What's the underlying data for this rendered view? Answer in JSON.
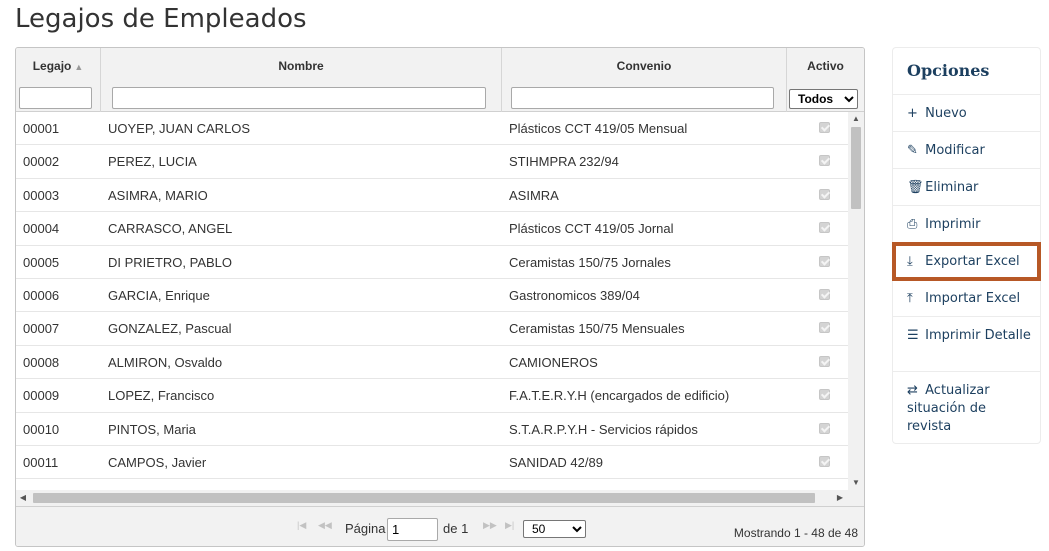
{
  "page": {
    "title": "Legajos de Empleados"
  },
  "grid": {
    "columns": {
      "legajo": "Legajo",
      "nombre": "Nombre",
      "convenio": "Convenio",
      "activo": "Activo"
    },
    "activo_filter": "Todos",
    "rows": [
      {
        "legajo": "00001",
        "nombre": "UOYEP, JUAN CARLOS",
        "convenio": "Plásticos CCT 419/05 Mensual",
        "activo": true
      },
      {
        "legajo": "00002",
        "nombre": "PEREZ, LUCIA",
        "convenio": "STIHMPRA 232/94",
        "activo": true
      },
      {
        "legajo": "00003",
        "nombre": "ASIMRA, MARIO",
        "convenio": "ASIMRA",
        "activo": true
      },
      {
        "legajo": "00004",
        "nombre": "CARRASCO, ANGEL",
        "convenio": "Plásticos CCT 419/05 Jornal",
        "activo": true
      },
      {
        "legajo": "00005",
        "nombre": "DI PRIETRO, PABLO",
        "convenio": "Ceramistas 150/75 Jornales",
        "activo": true
      },
      {
        "legajo": "00006",
        "nombre": "GARCIA, Enrique",
        "convenio": "Gastronomicos 389/04",
        "activo": true
      },
      {
        "legajo": "00007",
        "nombre": "GONZALEZ, Pascual",
        "convenio": "Ceramistas 150/75 Mensuales",
        "activo": true
      },
      {
        "legajo": "00008",
        "nombre": "ALMIRON, Osvaldo",
        "convenio": "CAMIONEROS",
        "activo": true
      },
      {
        "legajo": "00009",
        "nombre": "LOPEZ, Francisco",
        "convenio": "F.A.T.E.R.Y.H (encargados de edificio)",
        "activo": true
      },
      {
        "legajo": "00010",
        "nombre": "PINTOS, Maria",
        "convenio": "S.T.A.R.P.Y.H - Servicios rápidos",
        "activo": true
      },
      {
        "legajo": "00011",
        "nombre": "CAMPOS, Javier",
        "convenio": "SANIDAD 42/89",
        "activo": true
      }
    ],
    "pager": {
      "page_label": "Página",
      "page_value": "1",
      "of_label": "de 1",
      "page_size": "50",
      "info": "Mostrando 1 - 48 de 48"
    }
  },
  "options": {
    "title": "Opciones",
    "items": [
      {
        "icon": "plus-icon",
        "glyph": "+",
        "label": "Nuevo"
      },
      {
        "icon": "pencil-icon",
        "glyph": "✎",
        "label": "Modificar"
      },
      {
        "icon": "trash-icon",
        "glyph": "🗑",
        "label": "Eliminar"
      },
      {
        "icon": "printer-icon",
        "glyph": "⎙",
        "label": "Imprimir"
      },
      {
        "icon": "download-icon",
        "glyph": "⤓",
        "label": "Exportar Excel",
        "highlighted": true
      },
      {
        "icon": "upload-icon",
        "glyph": "⤒",
        "label": "Importar Excel"
      },
      {
        "icon": "list-icon",
        "glyph": "☰",
        "label": "Imprimir Detalle"
      },
      {
        "icon": "refresh-icon",
        "glyph": "⇄",
        "label": "Actualizar situación de revista"
      }
    ]
  },
  "colors": {
    "accent": "#1c3f5f",
    "highlight_border": "#b75826"
  }
}
